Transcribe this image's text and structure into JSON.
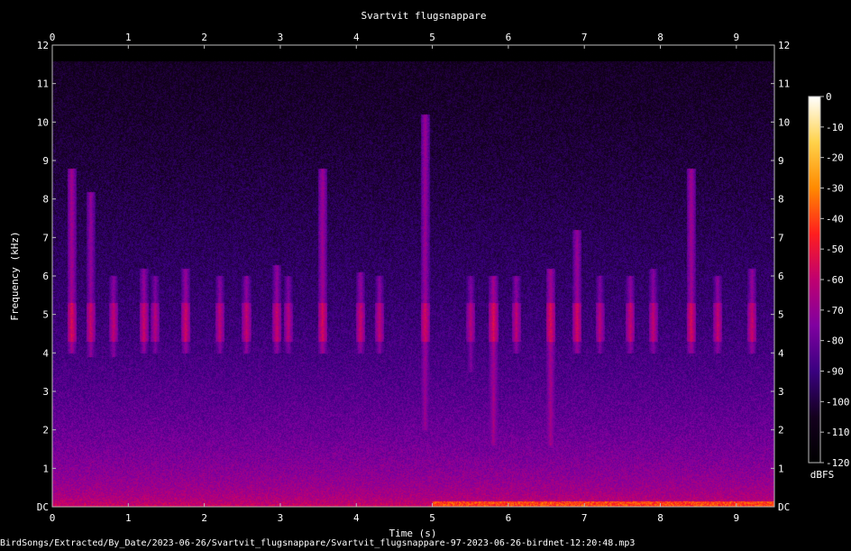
{
  "chart_data": {
    "type": "heatmap",
    "title": "Svartvit flugsnappare",
    "xlabel": "Time (s)",
    "ylabel": "Frequency (kHz)",
    "x_ticks": [
      "0",
      "1",
      "2",
      "3",
      "4",
      "5",
      "6",
      "7",
      "8",
      "9"
    ],
    "y_ticks": [
      "DC",
      "1",
      "2",
      "3",
      "4",
      "5",
      "6",
      "7",
      "8",
      "9",
      "10",
      "11",
      "12"
    ],
    "xlim": [
      0,
      9.5
    ],
    "ylim": [
      0,
      12
    ],
    "colorbar": {
      "label": "dBFS",
      "ticks": [
        "0",
        "-10",
        "-20",
        "-30",
        "-40",
        "-50",
        "-60",
        "-70",
        "-80",
        "-90",
        "-100",
        "-110",
        "-120"
      ],
      "range": [
        -120,
        0
      ],
      "colormap": [
        "#000000",
        "#14001e",
        "#3a0080",
        "#8000a0",
        "#c00070",
        "#ff1e1e",
        "#ff8a00",
        "#ffd24a",
        "#ffffff"
      ]
    },
    "calls": [
      {
        "t": 0.25,
        "f_low": 4.0,
        "f_high": 8.8,
        "level": -62
      },
      {
        "t": 0.5,
        "f_low": 3.9,
        "f_high": 8.2,
        "level": -66
      },
      {
        "t": 0.8,
        "f_low": 3.9,
        "f_high": 6.0,
        "level": -68
      },
      {
        "t": 1.2,
        "f_low": 4.0,
        "f_high": 6.2,
        "level": -66
      },
      {
        "t": 1.35,
        "f_low": 4.0,
        "f_high": 6.0,
        "level": -70
      },
      {
        "t": 1.75,
        "f_low": 4.0,
        "f_high": 6.2,
        "level": -65
      },
      {
        "t": 2.2,
        "f_low": 4.0,
        "f_high": 6.0,
        "level": -68
      },
      {
        "t": 2.55,
        "f_low": 4.0,
        "f_high": 6.0,
        "level": -67
      },
      {
        "t": 2.95,
        "f_low": 4.0,
        "f_high": 6.3,
        "level": -66
      },
      {
        "t": 3.1,
        "f_low": 4.0,
        "f_high": 6.0,
        "level": -70
      },
      {
        "t": 3.55,
        "f_low": 4.0,
        "f_high": 8.8,
        "level": -63
      },
      {
        "t": 4.05,
        "f_low": 4.0,
        "f_high": 6.1,
        "level": -66
      },
      {
        "t": 4.3,
        "f_low": 4.0,
        "f_high": 6.0,
        "level": -68
      },
      {
        "t": 4.9,
        "f_low": 2.0,
        "f_high": 10.2,
        "level": -64
      },
      {
        "t": 5.5,
        "f_low": 3.5,
        "f_high": 6.0,
        "level": -70
      },
      {
        "t": 5.8,
        "f_low": 1.6,
        "f_high": 6.0,
        "level": -62
      },
      {
        "t": 6.1,
        "f_low": 4.0,
        "f_high": 6.0,
        "level": -68
      },
      {
        "t": 6.55,
        "f_low": 1.6,
        "f_high": 6.2,
        "level": -62
      },
      {
        "t": 6.9,
        "f_low": 4.0,
        "f_high": 7.2,
        "level": -64
      },
      {
        "t": 7.2,
        "f_low": 4.0,
        "f_high": 6.0,
        "level": -70
      },
      {
        "t": 7.6,
        "f_low": 4.0,
        "f_high": 6.0,
        "level": -67
      },
      {
        "t": 7.9,
        "f_low": 4.0,
        "f_high": 6.2,
        "level": -68
      },
      {
        "t": 8.4,
        "f_low": 4.0,
        "f_high": 8.8,
        "level": -63
      },
      {
        "t": 8.75,
        "f_low": 4.0,
        "f_high": 6.0,
        "level": -67
      },
      {
        "t": 9.2,
        "f_low": 4.0,
        "f_high": 6.2,
        "level": -66
      }
    ],
    "noise_floor": {
      "f_max": 11.6,
      "level_top": -105,
      "level_bottom": -50
    }
  },
  "footer": {
    "path": "BirdSongs/Extracted/By_Date/2023-06-26/Svartvit_flugsnappare/Svartvit_flugsnappare-97-2023-06-26-birdnet-12:20:48.mp3"
  }
}
